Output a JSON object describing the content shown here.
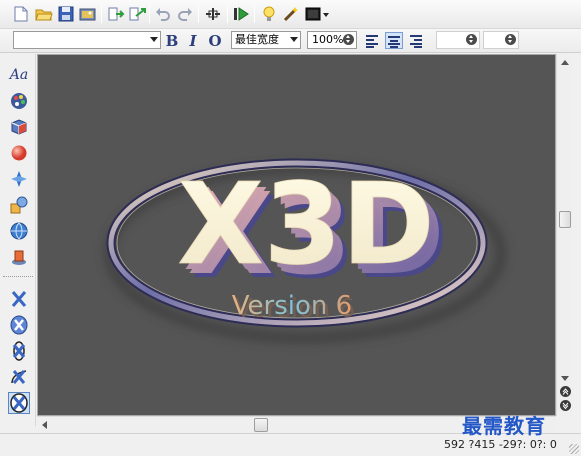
{
  "toolbar_top": {
    "buttons": [
      {
        "name": "new-document-icon"
      },
      {
        "name": "open-folder-icon"
      },
      {
        "name": "save-icon"
      },
      {
        "name": "save-image-icon"
      },
      {
        "name": "import-icon"
      },
      {
        "name": "export-icon"
      },
      {
        "name": "undo-icon"
      },
      {
        "name": "redo-icon"
      },
      {
        "name": "preview-icon"
      },
      {
        "name": "play-animation-icon"
      },
      {
        "name": "light-bulb-icon"
      },
      {
        "name": "magic-wand-icon"
      },
      {
        "name": "background-icon"
      }
    ]
  },
  "toolbar_format": {
    "font_value": "",
    "bold_label": "B",
    "italic_label": "I",
    "outline_label": "O",
    "width_mode": "最佳宽度",
    "zoom": "100%",
    "field_a": "",
    "field_b": ""
  },
  "left_toolbar": {
    "items": [
      {
        "name": "text-style-icon",
        "label": "Aa"
      },
      {
        "name": "palette-icon"
      },
      {
        "name": "bevel-icon"
      },
      {
        "name": "sphere-icon"
      },
      {
        "name": "light-icon"
      },
      {
        "name": "shapes-icon"
      },
      {
        "name": "globe-icon"
      },
      {
        "name": "background-scene-icon"
      },
      {
        "name": "x-rotate-icon"
      },
      {
        "name": "x-spin-icon"
      },
      {
        "name": "x-orbit-icon"
      },
      {
        "name": "x-swing-icon"
      },
      {
        "name": "x-selected-icon"
      }
    ]
  },
  "canvas": {
    "logo_text": "X3D",
    "subtitle": "Version 6",
    "background": "#555555"
  },
  "status": {
    "coordinates": "592 ?415  -29?: 0?: 0"
  },
  "watermark": "最需教育",
  "colors": {
    "accent_blue": "#2458c8",
    "icon_blue": "#233a74"
  }
}
